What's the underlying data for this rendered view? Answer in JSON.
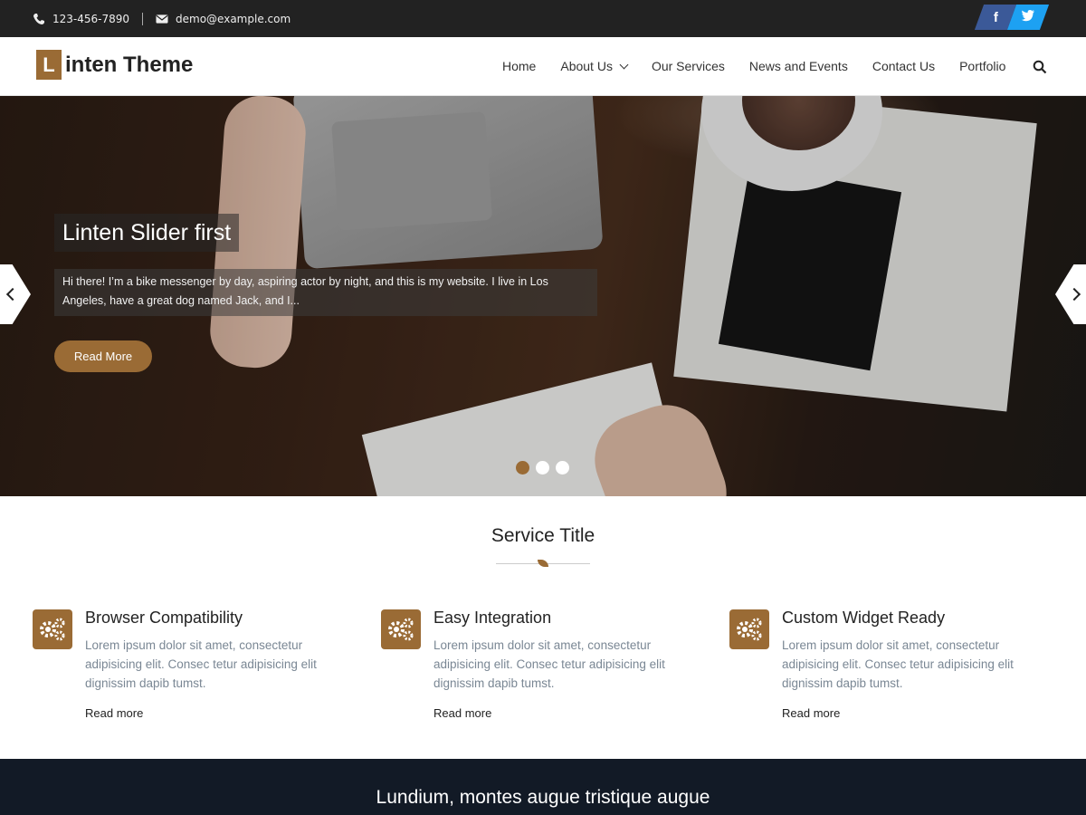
{
  "topbar": {
    "phone": "123-456-7890",
    "email": "demo@example.com",
    "social": [
      {
        "icon": "facebook-icon",
        "glyph": "f"
      },
      {
        "icon": "twitter-icon",
        "glyph": "t"
      }
    ]
  },
  "header": {
    "logo_letter": "L",
    "logo_text": "inten Theme",
    "nav": [
      {
        "label": "Home"
      },
      {
        "label": "About Us"
      },
      {
        "label": "Our Services"
      },
      {
        "label": "News and Events"
      },
      {
        "label": "Contact Us"
      },
      {
        "label": "Portfolio"
      }
    ]
  },
  "slider": {
    "title": "Linten Slider first",
    "text": "Hi there! I’m a bike messenger by day, aspiring actor by night, and this is my website. I live in Los Angeles, have a great dog named Jack, and I...",
    "button": "Read More",
    "slide_count": 3,
    "active_slide": 1
  },
  "services": {
    "heading": "Service Title",
    "items": [
      {
        "title": "Browser Compatibility",
        "desc": "Lorem ipsum dolor sit amet, consectetur adipisicing elit. Consec tetur adipisicing elit dignissim dapib tumst.",
        "link": "Read more"
      },
      {
        "title": "Easy Integration",
        "desc": "Lorem ipsum dolor sit amet, consectetur adipisicing elit. Consec tetur adipisicing elit dignissim dapib tumst.",
        "link": "Read more"
      },
      {
        "title": "Custom Widget Ready",
        "desc": "Lorem ipsum dolor sit amet, consectetur adipisicing elit. Consec tetur adipisicing elit dignissim dapib tumst.",
        "link": "Read more"
      }
    ]
  },
  "footer": {
    "text": "Lundium, montes augue tristique augue"
  },
  "colors": {
    "accent": "#9a6b35",
    "topbar_bg": "#222222",
    "footer_bg": "#121a26"
  }
}
